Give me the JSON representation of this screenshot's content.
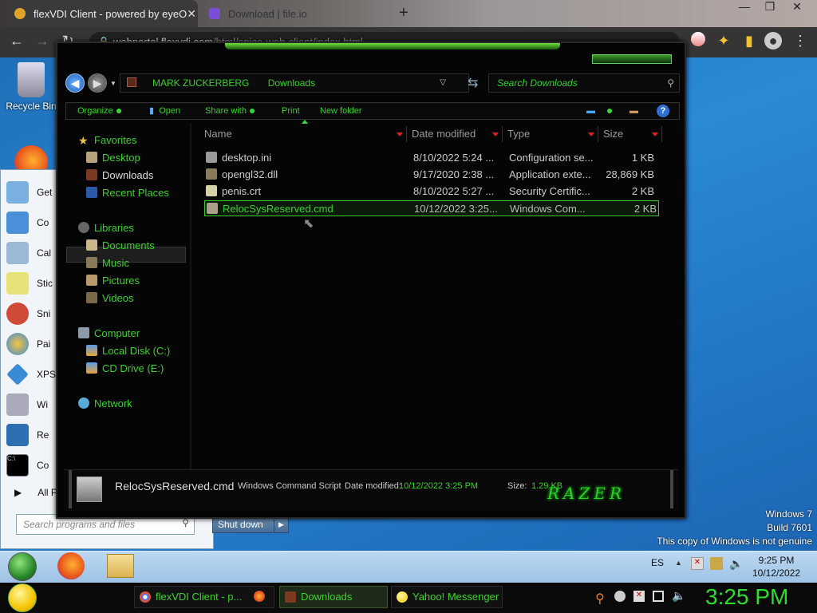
{
  "browser": {
    "tabs": [
      {
        "label": "flexVDI Client - powered by eyeO"
      },
      {
        "label": "Download | file.io"
      }
    ],
    "new_tab": "+",
    "url_host": "webportal.flexvdi.com",
    "url_path": "/html/spice-web-client/index.html"
  },
  "desktop": {
    "recycle_bin": "Recycle Bin",
    "watermark_line1": "Windows 7",
    "watermark_line2": "Build 7601",
    "watermark_line3": "This copy of Windows is not genuine"
  },
  "start_menu": {
    "items": [
      "Get",
      "Co",
      "Cal",
      "Stic",
      "Sni",
      "Pai",
      "XPS",
      "Wi",
      "Re",
      "Co"
    ],
    "all_programs": "All P",
    "search_placeholder": "Search programs and files",
    "shutdown": "Shut down"
  },
  "explorer": {
    "breadcrumb": [
      "MARK ZUCKERBERG",
      "Downloads"
    ],
    "search_placeholder": "Search Downloads",
    "toolbar": {
      "organize": "Organize",
      "open": "Open",
      "share_with": "Share with",
      "print": "Print",
      "new_folder": "New folder"
    },
    "nav": {
      "favorites": "Favorites",
      "desktop": "Desktop",
      "downloads": "Downloads",
      "recent_places": "Recent Places",
      "libraries": "Libraries",
      "documents": "Documents",
      "music": "Music",
      "pictures": "Pictures",
      "videos": "Videos",
      "computer": "Computer",
      "local_disk": "Local Disk (C:)",
      "cd_drive": "CD Drive (E:)",
      "network": "Network"
    },
    "columns": {
      "name": "Name",
      "date": "Date modified",
      "type": "Type",
      "size": "Size"
    },
    "files": [
      {
        "name": "desktop.ini",
        "date": "8/10/2022 5:24 ...",
        "type": "Configuration se...",
        "size": "1 KB"
      },
      {
        "name": "opengl32.dll",
        "date": "9/17/2020 2:38 ...",
        "type": "Application exte...",
        "size": "28,869 KB"
      },
      {
        "name": "penis.crt",
        "date": "8/10/2022 5:27 ...",
        "type": "Security Certific...",
        "size": "2 KB"
      },
      {
        "name": "RelocSysReserved.cmd",
        "date": "10/12/2022 3:25...",
        "type": "Windows Com...",
        "size": "2 KB"
      }
    ],
    "details": {
      "filename": "RelocSysReserved.cmd",
      "filetype": "Windows Command Script",
      "date_label": "Date modified:",
      "date_value": "10/12/2022 3:25 PM",
      "size_label": "Size:",
      "size_value": "1.29 KB",
      "logo": "RAZER"
    }
  },
  "taskbar_inner": {
    "lang": "ES",
    "time": "9:25 PM",
    "date": "10/12/2022"
  },
  "taskbar_host": {
    "buttons": [
      "flexVDI Client - p...",
      "Downloads",
      "Yahoo! Messenger"
    ],
    "clock": "3:25 PM"
  }
}
